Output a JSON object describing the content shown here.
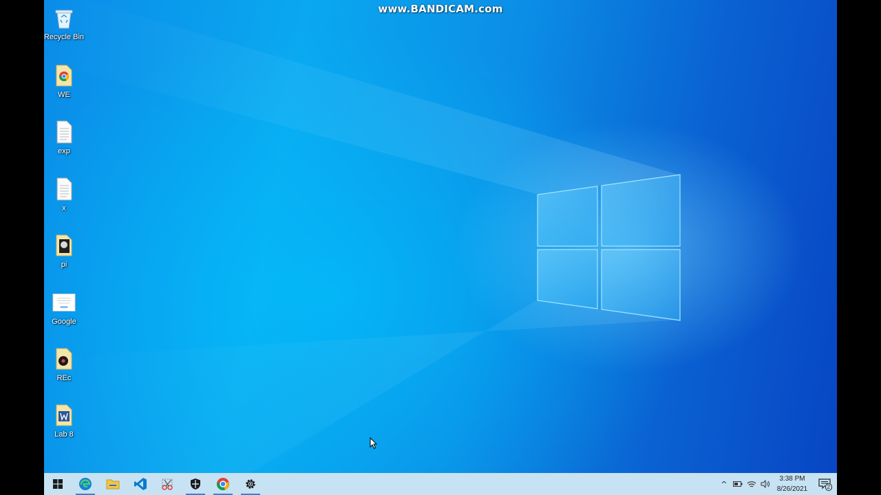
{
  "watermark": "www.BANDICAM.com",
  "desktop_icons": [
    {
      "label": "Recycle Bin",
      "icon": "recycle-bin-icon"
    },
    {
      "label": "WE",
      "icon": "chrome-shortcut-file-icon"
    },
    {
      "label": "exp",
      "icon": "text-document-icon"
    },
    {
      "label": "x",
      "icon": "text-document-icon"
    },
    {
      "label": "pi",
      "icon": "image-file-icon"
    },
    {
      "label": "Google",
      "icon": "webpage-thumbnail-icon"
    },
    {
      "label": "REc",
      "icon": "media-file-icon"
    },
    {
      "label": "Lab 8",
      "icon": "word-document-icon"
    }
  ],
  "taskbar": {
    "apps": [
      "start-icon",
      "edge-icon",
      "file-explorer-icon",
      "vscode-icon",
      "snipping-tool-icon",
      "windows-security-icon",
      "chrome-icon",
      "settings-icon"
    ]
  },
  "tray": {
    "overflow_glyph": "^",
    "time": "3:38 PM",
    "date": "8/26/2021",
    "notification_count": "2"
  },
  "colors": {
    "taskbar_bg": "#c7e2f3",
    "wallpaper_blue": "#0a8ce8",
    "running_indicator": "#3b7fd0"
  }
}
